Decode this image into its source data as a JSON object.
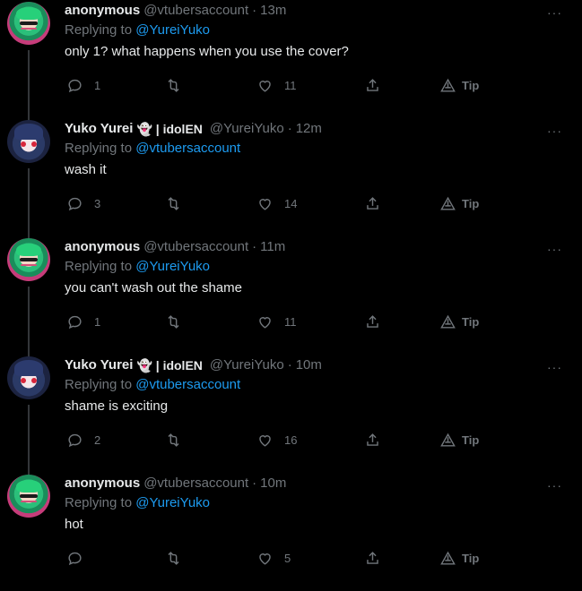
{
  "tweets": [
    {
      "name": "anonymous",
      "ghost": "",
      "handle": "@vtubersaccount",
      "time": "13m",
      "replying_label": "Replying to",
      "replying_to": "@YureiYuko",
      "text": "only 1? what happens when you use the cover?",
      "replies": "1",
      "retweets": "",
      "likes": "11",
      "tip": "Tip",
      "avatar": "anonymous"
    },
    {
      "name": "Yuko Yurei",
      "ghost": "👻 | idolEN",
      "handle": "@YureiYuko",
      "time": "12m",
      "replying_label": "Replying to",
      "replying_to": "@vtubersaccount",
      "text": "wash it",
      "replies": "3",
      "retweets": "",
      "likes": "14",
      "tip": "Tip",
      "avatar": "yuko"
    },
    {
      "name": "anonymous",
      "ghost": "",
      "handle": "@vtubersaccount",
      "time": "11m",
      "replying_label": "Replying to",
      "replying_to": "@YureiYuko",
      "text": "you can't wash out the shame",
      "replies": "1",
      "retweets": "",
      "likes": "11",
      "tip": "Tip",
      "avatar": "anonymous"
    },
    {
      "name": "Yuko Yurei",
      "ghost": "👻 | idolEN",
      "handle": "@YureiYuko",
      "time": "10m",
      "replying_label": "Replying to",
      "replying_to": "@vtubersaccount",
      "text": "shame is exciting",
      "replies": "2",
      "retweets": "",
      "likes": "16",
      "tip": "Tip",
      "avatar": "yuko"
    },
    {
      "name": "anonymous",
      "ghost": "",
      "handle": "@vtubersaccount",
      "time": "10m",
      "replying_label": "Replying to",
      "replying_to": "@YureiYuko",
      "text": "hot",
      "replies": "",
      "retweets": "",
      "likes": "5",
      "tip": "Tip",
      "avatar": "anonymous"
    }
  ],
  "more_label": "···",
  "dot": "·",
  "colors": {
    "background": "#000000",
    "text": "#e7e9ea",
    "muted": "#71767b",
    "link": "#1d9bf0",
    "thread_line": "#333639"
  }
}
